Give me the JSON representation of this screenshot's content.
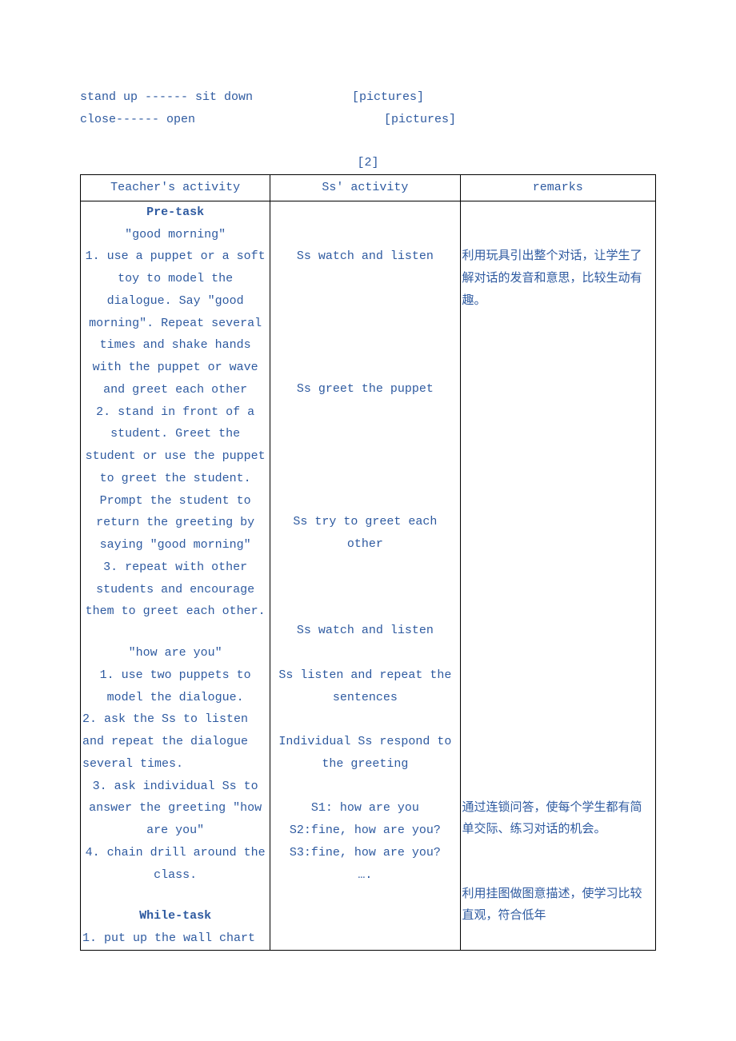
{
  "top": {
    "line1_left": "stand up ------ sit down",
    "line1_right": "[pictures]",
    "line2_left": "close------ open",
    "line2_right": "[pictures]"
  },
  "marker": "[2]",
  "headers": {
    "teacher": "Teacher's activity",
    "ss": "Ss'  activity",
    "remarks": "remarks"
  },
  "body": {
    "colA": {
      "pretask": "Pre-task",
      "gm_title": "\"good morning\"",
      "p1": "1. use a puppet or a soft toy to model the dialogue. Say \"good morning\". Repeat several times and shake hands with the puppet or wave and greet each other",
      "p2": "2. stand in front of a student. Greet the student or use the puppet to greet the student. Prompt the student to return the greeting by saying \"good morning\"",
      "p3": "3. repeat with other students and encourage them to greet each other.",
      "hay_title": "\"how are you\"",
      "q1": "1. use two puppets to model the dialogue.",
      "q2": "2. ask the Ss to listen and repeat the dialogue several times.",
      "q3": "3. ask individual Ss to answer the greeting \"how are you\"",
      "q4": "4. chain drill around the class.",
      "whiletask": "While-task",
      "w1": "1. put up the wall chart"
    },
    "colB": {
      "b1": "Ss watch and listen",
      "b2": "Ss greet the puppet",
      "b3": "Ss try to greet each other",
      "b4": "Ss watch and listen",
      "b5": "Ss listen and repeat the sentences",
      "b6": "Individual Ss respond to the greeting",
      "b7a": "S1: how are you",
      "b7b": "S2:fine, how are you?",
      "b7c": "S3:fine, how are you?",
      "b7d": "…."
    },
    "colC": {
      "c1": "利用玩具引出整个对话，让学生了解对话的发音和意思，比较生动有趣。",
      "c2": "通过连锁问答，使每个学生都有简单交际、练习对话的机会。",
      "c3": "利用挂图做图意描述，使学习比较直观，符合低年"
    }
  }
}
